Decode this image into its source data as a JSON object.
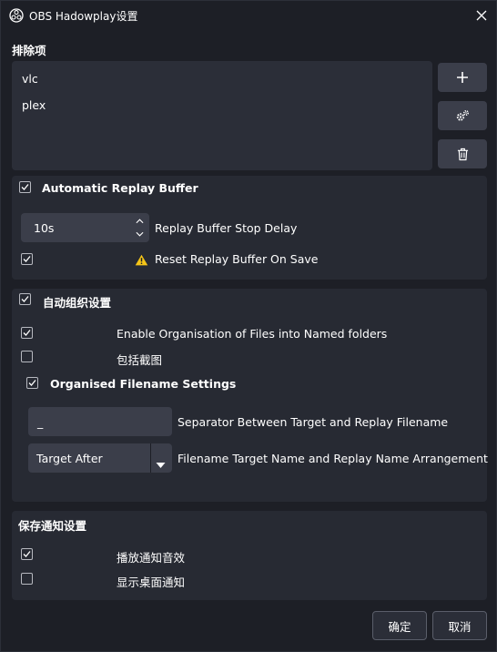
{
  "window": {
    "title": "OBS Hadowplay设置",
    "title_icon": "obs-logo-icon",
    "close_icon": "close-icon"
  },
  "exclusions": {
    "section_title": "排除项",
    "items": [
      "vlc",
      "plex"
    ],
    "add_icon": "plus-icon",
    "config_icon": "gears-icon",
    "delete_icon": "trash-icon"
  },
  "replay_buffer": {
    "header_label": "Automatic Replay Buffer",
    "header_checked": true,
    "stop_delay_value": "10s",
    "stop_delay_label": "Replay Buffer Stop Delay",
    "reset_on_save_label": "Reset Replay Buffer On Save",
    "reset_on_save_checked": true,
    "warning_icon": "warning-icon",
    "warning_color": "#f5c518"
  },
  "organisation": {
    "header_label": "自动组织设置",
    "header_checked": true,
    "enable_named_folders_label": "Enable Organisation of Files into Named folders",
    "enable_named_folders_checked": true,
    "include_screenshots_label": "包括截图",
    "include_screenshots_checked": false,
    "filename_settings_label": "Organised Filename Settings",
    "filename_settings_checked": true,
    "separator_value": "_",
    "separator_label": "Separator Between Target and Replay Filename",
    "arrangement_value": "Target After",
    "arrangement_label": "Filename Target Name and Replay Name Arrangement"
  },
  "notifications": {
    "section_title": "保存通知设置",
    "play_sound_label": "播放通知音效",
    "play_sound_checked": true,
    "desktop_notification_label": "显示桌面通知",
    "desktop_notification_checked": false
  },
  "footer": {
    "ok_label": "确定",
    "cancel_label": "取消"
  },
  "colors": {
    "background": "#1d1f26",
    "panel": "#272a33",
    "input": "#3b3e4a",
    "text": "#ffffff"
  }
}
